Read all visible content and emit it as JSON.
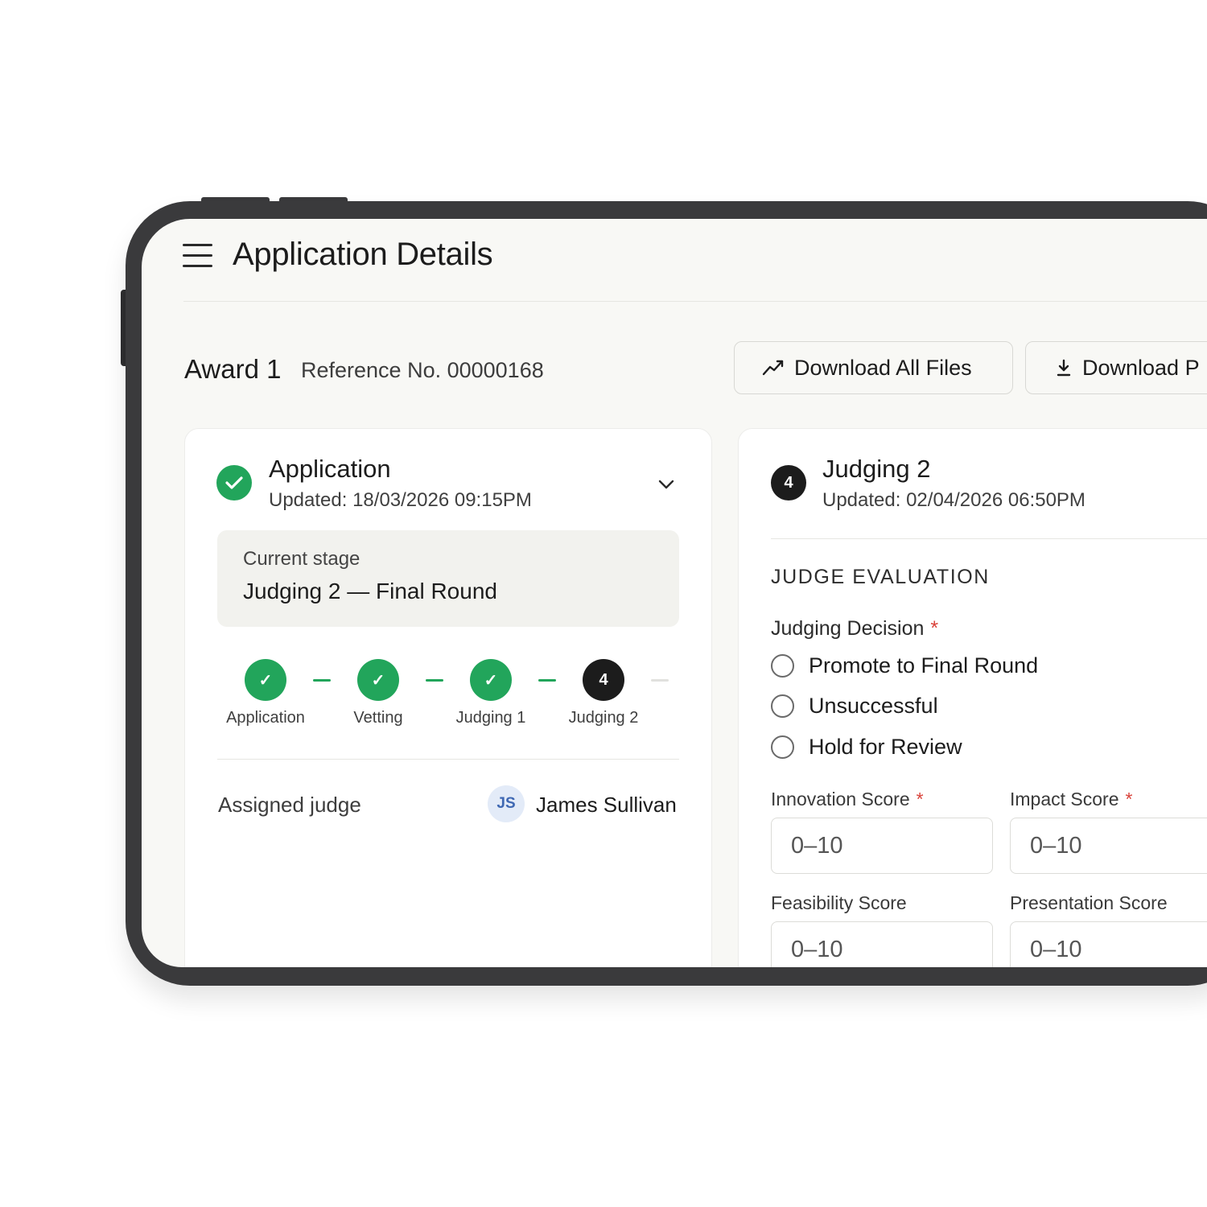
{
  "header": {
    "title": "Application Details"
  },
  "award": {
    "name": "Award 1",
    "reference": "Reference No. 00000168"
  },
  "toolbar": {
    "download_all_label": "Download All Files",
    "download_pdf_label": "Download P",
    "download_all_icon": "trend-line-icon",
    "download_pdf_icon": "download-icon"
  },
  "application_card": {
    "title": "Application",
    "updated": "Updated: 18/03/2026 09:15PM",
    "current_stage_label": "Current stage",
    "current_stage_value": "Judging 2 — Final Round",
    "steps": [
      {
        "label": "Application",
        "status": "done",
        "marker": "✓"
      },
      {
        "label": "Vetting",
        "status": "done",
        "marker": "✓"
      },
      {
        "label": "Judging 1",
        "status": "done",
        "marker": "✓"
      },
      {
        "label": "Judging 2",
        "status": "current",
        "marker": "4"
      }
    ],
    "assigned_judge_label": "Assigned judge",
    "judge_initials": "JS",
    "judge_name": "James Sullivan"
  },
  "judging_card": {
    "badge": "4",
    "title": "Judging 2",
    "updated": "Updated: 02/04/2026 06:50PM",
    "section_title": "JUDGE EVALUATION",
    "decision_label": "Judging Decision",
    "required_mark": "*",
    "decision_options": [
      "Promote to Final Round",
      "Unsuccessful",
      "Hold for Review"
    ],
    "scores": [
      {
        "label": "Innovation Score",
        "required": true,
        "placeholder": "0–10"
      },
      {
        "label": "Impact Score",
        "required": true,
        "placeholder": "0–10"
      },
      {
        "label": "Feasibility Score",
        "required": false,
        "placeholder": "0–10"
      },
      {
        "label": "Presentation Score",
        "required": false,
        "placeholder": "0–10"
      }
    ]
  },
  "colors": {
    "success": "#22a55b",
    "dark": "#1c1c1c",
    "required": "#d9423a",
    "device": "#3a3a3c"
  }
}
